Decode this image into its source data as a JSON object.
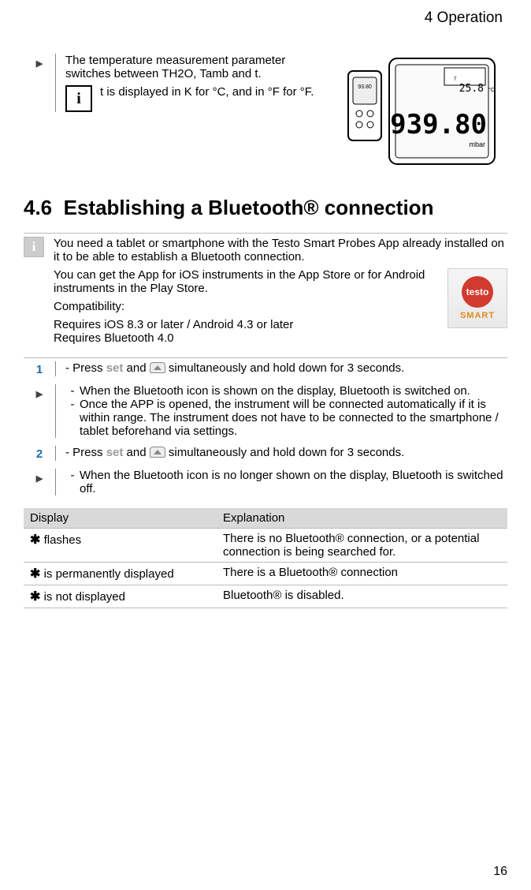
{
  "chapter_header": "4 Operation",
  "top_paragraph": "The temperature measurement parameter switches between TH2O, Tamb and   t.",
  "top_note": "  t is displayed in K for °C, and in °F for °F.",
  "section_number": "4.6",
  "section_title": "Establishing a Bluetooth® connection",
  "info_p1": "You need a tablet or smartphone with the Testo Smart Probes App already installed on it to be able to establish a Bluetooth connection.",
  "info_p2": "You can get the App for iOS instruments in the App Store or for Android instruments in the Play Store.",
  "info_compat_label": "Compatibility:",
  "info_req_line1": "Requires iOS 8.3 or later / Android 4.3 or later",
  "info_req_line2": "Requires Bluetooth 4.0",
  "app_badge_brand": "testo",
  "app_badge_label": "SMART",
  "step1_prefix": "- Press ",
  "set_label": "set",
  "step1_mid": " and ",
  "step1_suffix": " simultaneously and hold down for 3 seconds.",
  "step1_result_a": "When the Bluetooth icon is shown on the display, Bluetooth is switched on.",
  "step1_result_b": "Once the APP is opened, the instrument will be connected automatically if it is within range. The instrument does not have to be connected to the smartphone / tablet beforehand via settings.",
  "step2_prefix": "- Press ",
  "step2_mid": " and ",
  "step2_suffix": " simultaneously and hold down for 3 seconds.",
  "step2_result_a": "When the Bluetooth icon is no longer shown on the display, Bluetooth is switched off.",
  "table_header_display": "Display",
  "table_header_explanation": "Explanation",
  "table_row1_display": " flashes",
  "table_row1_explanation": "There is no Bluetooth® connection, or a potential connection is being searched for.",
  "table_row2_display": " is permanently displayed",
  "table_row2_explanation": "There is a Bluetooth® connection",
  "table_row3_display": " is not displayed",
  "table_row3_explanation": "Bluetooth® is disabled.",
  "page_number": "16"
}
